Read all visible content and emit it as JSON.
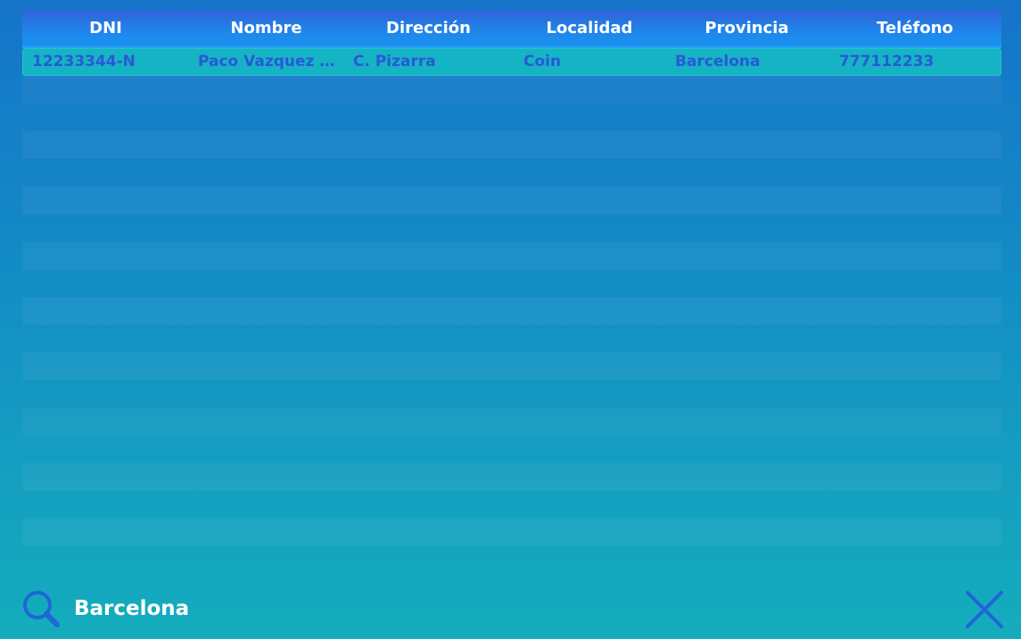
{
  "table": {
    "columns": [
      "DNI",
      "Nombre",
      "Dirección",
      "Localidad",
      "Provincia",
      "Teléfono"
    ],
    "rows": [
      {
        "dni": "12233344-N",
        "nombre": "Paco Vazquez Ga...",
        "direccion": "C. Pizarra",
        "localidad": "Coin",
        "provincia": "Barcelona",
        "telefono": "777112233"
      }
    ]
  },
  "search": {
    "value": "Barcelona",
    "icon": "search-icon"
  },
  "close": {
    "icon": "close-icon"
  },
  "colors": {
    "header_text": "#ffffff",
    "row_text": "#2a58d8",
    "selected_row": "#15b4c4",
    "icon": "#1f66d6"
  }
}
